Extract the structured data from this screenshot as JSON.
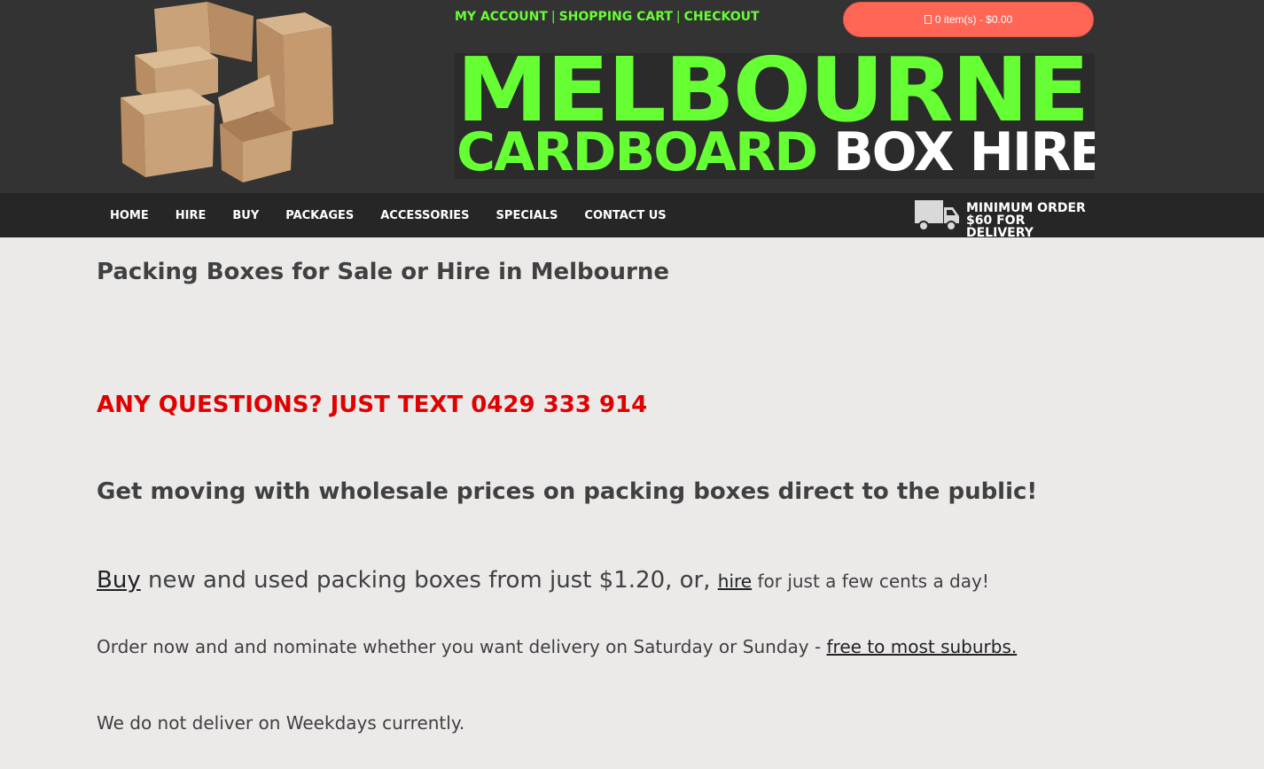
{
  "header": {
    "links": [
      "MY ACCOUNT",
      "SHOPPING CART",
      "CHECKOUT"
    ],
    "separator": "|",
    "cart_label": "0 item(s) - $0.00",
    "cart_icon": "cart-icon",
    "brand_line1": "MELBOURNE",
    "brand_line2_green": "CARDBOARD",
    "brand_line2_white": "BOX HIRE",
    "colors": {
      "accent_green": "#66ff33",
      "cart_button": "#ff6655",
      "header_bg": "#333333"
    }
  },
  "nav": {
    "items": [
      "HOME",
      "HIRE",
      "BUY",
      "PACKAGES",
      "ACCESSORIES",
      "SPECIALS",
      "CONTACT US"
    ],
    "delivery_icon": "truck-icon",
    "delivery_line1": "MINIMUM ORDER",
    "delivery_line2": "$60 FOR DELIVERY"
  },
  "main": {
    "title": "Packing Boxes for Sale or Hire in Melbourne",
    "questions": "ANY QUESTIONS?  JUST TEXT 0429 333 914",
    "tagline": "Get moving with wholesale prices on packing boxes direct to the public!",
    "buy_link": "Buy",
    "buy_text": " new and used packing boxes from just $1.20, or, ",
    "hire_link": "hire",
    "hire_text": " for just a few cents a day!",
    "order_text": "Order now and and nominate whether you want delivery on Saturday or Sunday - ",
    "order_link": "free to most suburbs.",
    "weekdays": "We do not deliver on Weekdays currently.",
    "colors": {
      "questions": "#e00000"
    }
  }
}
